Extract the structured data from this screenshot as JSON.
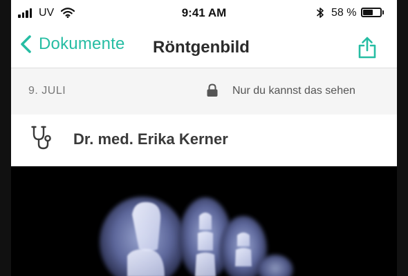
{
  "status_bar": {
    "carrier": "UV",
    "time": "9:41 AM",
    "battery_percent": "58 %",
    "battery_level": 0.58,
    "icons": [
      "signal-icon",
      "wifi-icon",
      "bluetooth-icon",
      "battery-icon"
    ]
  },
  "nav": {
    "back_label": "Dokumente",
    "title": "Röntgenbild",
    "share_icon": "share-icon",
    "back_icon": "chevron-left-icon"
  },
  "meta": {
    "date": "9. JULI",
    "privacy_icon": "lock-icon",
    "privacy_label": "Nur du kannst das sehen"
  },
  "doctor": {
    "icon": "stethoscope-icon",
    "name": "Dr. med. Erika Kerner"
  },
  "colors": {
    "accent": "#26bda3",
    "meta_background": "#f5f5f5",
    "image_background": "#000000"
  }
}
